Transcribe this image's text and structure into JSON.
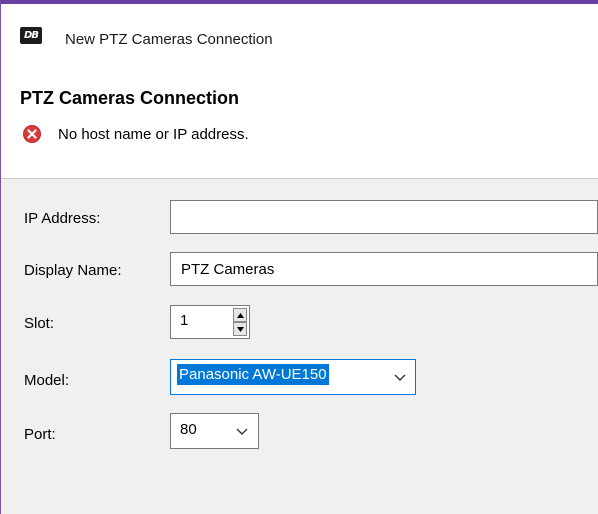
{
  "window": {
    "title": "New PTZ Cameras Connection",
    "app_icon_text": "DB"
  },
  "header": {
    "section_title": "PTZ Cameras Connection",
    "error_message": "No host name or IP address."
  },
  "form": {
    "ip_address": {
      "label": "IP Address:",
      "value": ""
    },
    "display_name": {
      "label": "Display Name:",
      "value": "PTZ Cameras"
    },
    "slot": {
      "label": "Slot:",
      "value": "1"
    },
    "model": {
      "label": "Model:",
      "value": "Panasonic AW-UE150"
    },
    "port": {
      "label": "Port:",
      "value": "80"
    }
  },
  "colors": {
    "accent": "#6b3fa0",
    "error": "#d83b3b",
    "selection": "#0078d7"
  }
}
